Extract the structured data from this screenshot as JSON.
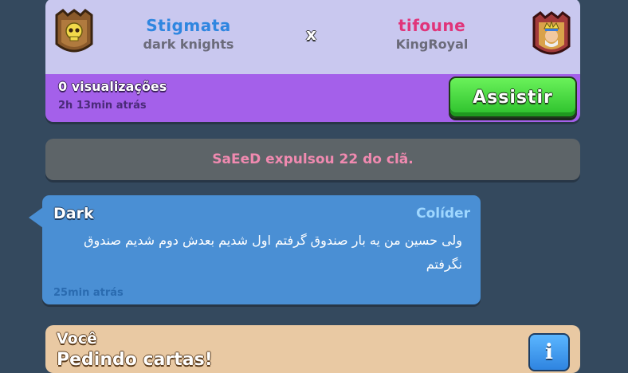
{
  "battle": {
    "player1": {
      "name": "Stigmata",
      "clan": "dark knights",
      "name_color": "#2f86e0"
    },
    "player2": {
      "name": "tifoune",
      "clan": "KingRoyal",
      "name_color": "#e0357a"
    },
    "vs_label": "x",
    "views": "0 visualizações",
    "time_ago": "2h 13min atrás",
    "watch_label": "Assistir"
  },
  "system_message": "SaEeD expulsou 22 do clã.",
  "chat": {
    "sender": "Dark",
    "role": "Colíder",
    "message": "ولی حسین من یه بار صندوق گرفتم اول شدیم بعدش دوم شدیم صندوق نگرفتم",
    "time_ago": "25min atrás"
  },
  "request": {
    "owner": "Você",
    "text": "Pedindo cartas!",
    "info_icon": "info-icon"
  },
  "colors": {
    "background": "#34495e",
    "battle_top": "#c9c8ef",
    "battle_bottom": "#a460ea",
    "watch_button": "#3dd53d",
    "chat_bubble": "#4a8fd4",
    "system_text": "#f08ab0"
  }
}
